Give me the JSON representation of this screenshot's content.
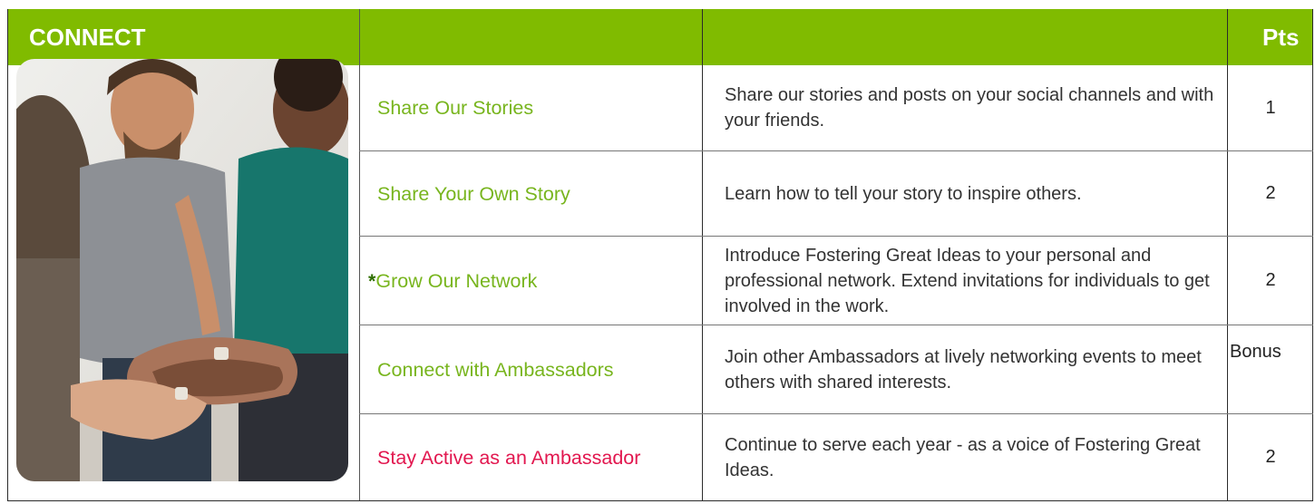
{
  "header": {
    "section_title": "CONNECT",
    "points_label": "Pts"
  },
  "colors": {
    "header_green": "#80bb00",
    "activity_green": "#78b51e",
    "activity_red": "#e2174f",
    "star_green": "#2f6e00"
  },
  "photo": {
    "icon": "team-hands-stacked-photo"
  },
  "rows": [
    {
      "activity": "Share Our Stories",
      "description": "Share our stories and posts on your social channels and with your friends.",
      "points": "1"
    },
    {
      "activity": "Share Your Own Story",
      "description": "Learn how to tell your story to inspire others.",
      "points": "2"
    },
    {
      "star": "*",
      "activity": "Grow Our Network",
      "description": "Introduce Fostering Great Ideas to your personal and professional network. Extend invitations for individuals to get involved in the work.",
      "points": "2"
    },
    {
      "activity": "Connect with Ambassadors",
      "description": "Join other Ambassadors at lively networking events to meet others with shared interests.",
      "points": "Bonus"
    },
    {
      "activity": "Stay Active as an Ambassador",
      "description": "Continue to serve each year - as a voice of Fostering Great Ideas.",
      "points": "2"
    }
  ]
}
